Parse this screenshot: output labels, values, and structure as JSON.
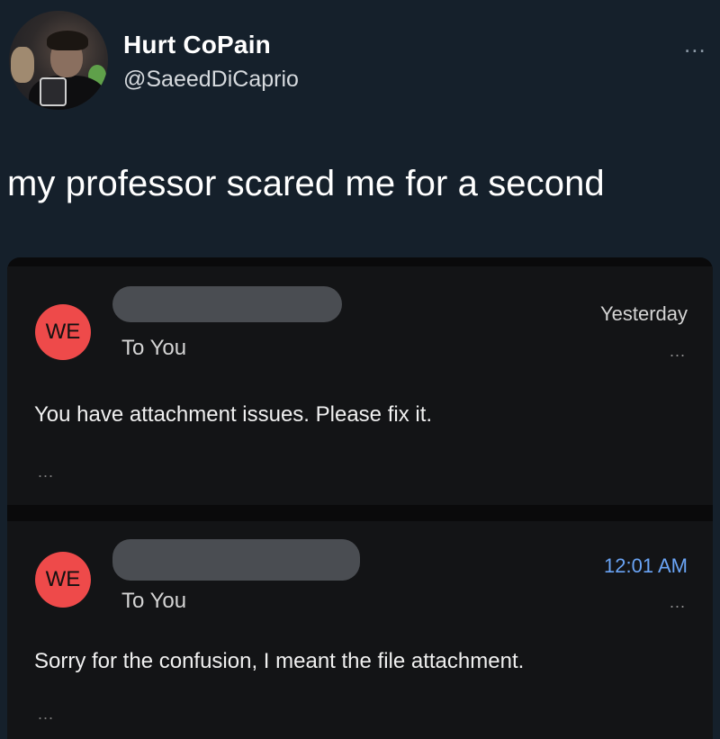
{
  "tweet": {
    "author_name": "Hurt CoPain",
    "handle": "@SaeedDiCaprio",
    "more": "...",
    "text": "my professor scared me for a second"
  },
  "emails": [
    {
      "avatar_initials": "WE",
      "to": "To You",
      "time": "Yesterday",
      "time_color": "#d4d4d4",
      "more": "...",
      "body": "You have attachment issues. Please fix it.",
      "body_more": "..."
    },
    {
      "avatar_initials": "WE",
      "to": "To You",
      "time": "12:01 AM",
      "time_color": "#6aa4f5",
      "more": "...",
      "body": "Sorry for the confusion, I meant the file attachment.",
      "body_more": "..."
    }
  ],
  "colors": {
    "background": "#15202b",
    "avatar_red": "#ee4a4a",
    "email_card": "#131416"
  }
}
